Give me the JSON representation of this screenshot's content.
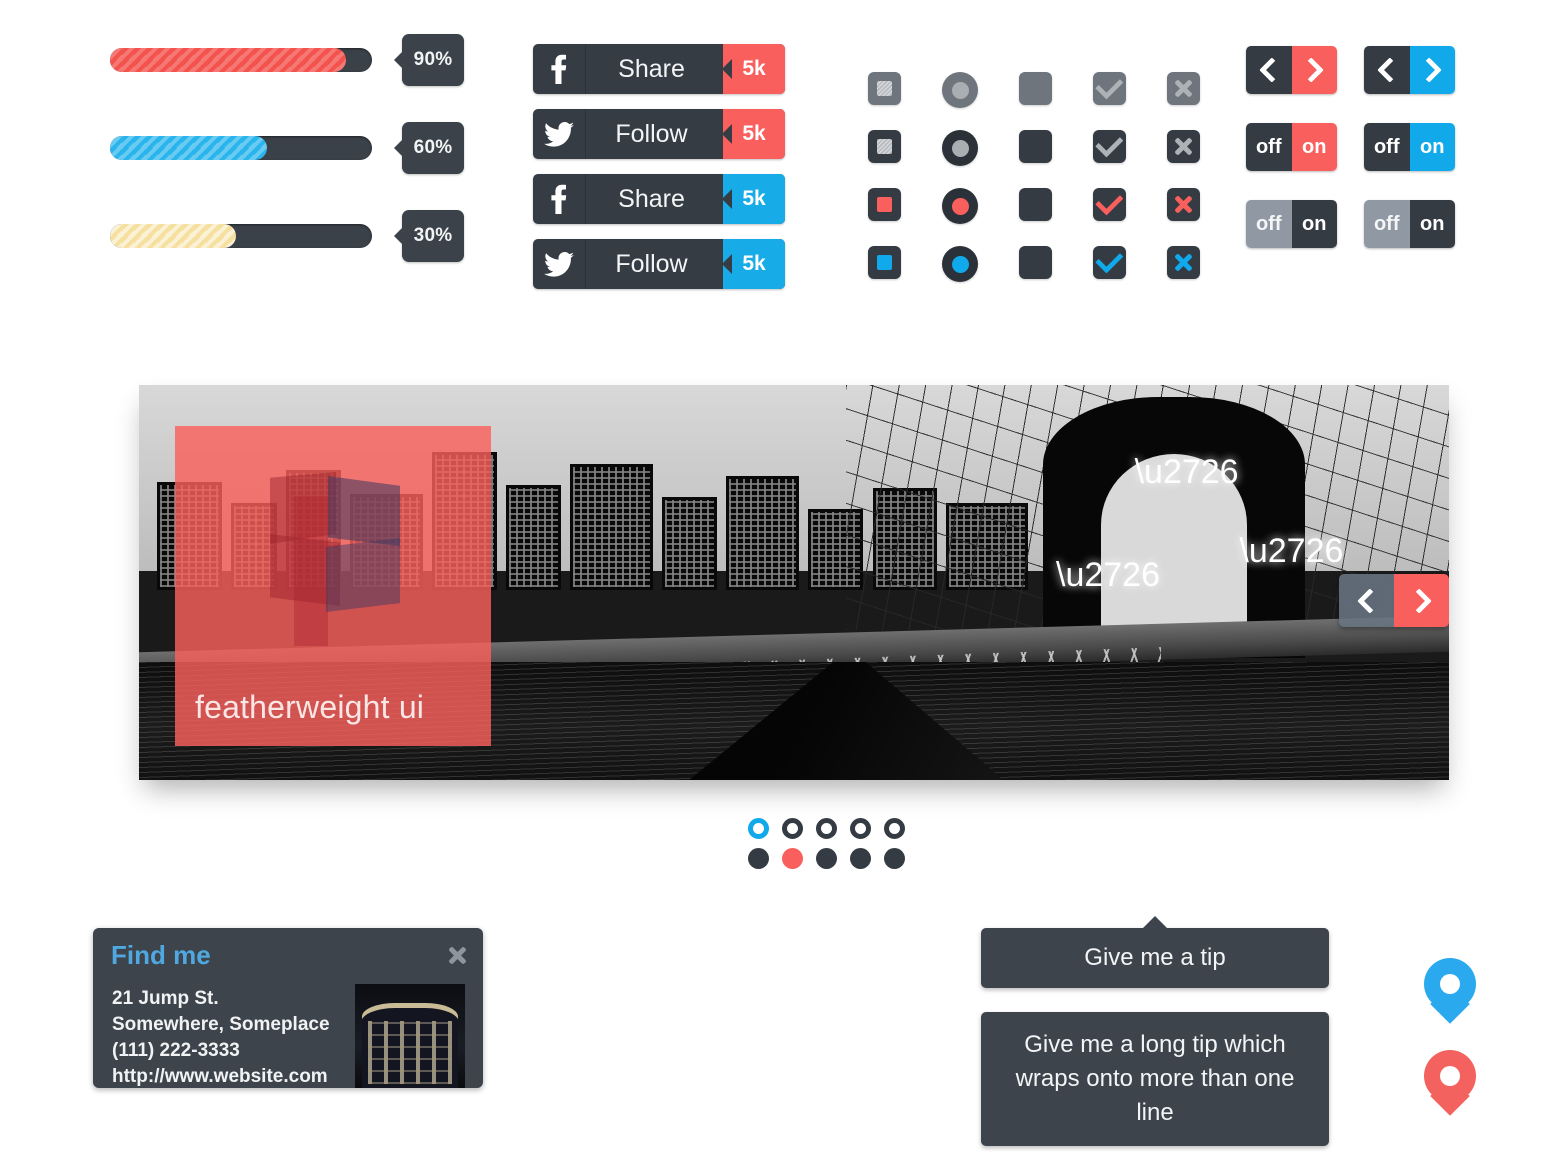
{
  "sliders": [
    {
      "value": "90%",
      "percent": 90,
      "color": "#f4524d",
      "name": "red"
    },
    {
      "value": "60%",
      "percent": 60,
      "color": "#2ab4ec",
      "name": "blue"
    },
    {
      "value": "30%",
      "percent": 30,
      "color": "#f6e0a0",
      "name": "yellow"
    }
  ],
  "social_buttons": [
    {
      "icon": "facebook-icon",
      "glyph": "f",
      "label": "Share",
      "count": "5k",
      "accent": "#f9605d"
    },
    {
      "icon": "twitter-icon",
      "glyph": "✉",
      "label": "Follow",
      "count": "5k",
      "accent": "#f9605d"
    },
    {
      "icon": "facebook-icon",
      "glyph": "f",
      "label": "Share",
      "count": "5k",
      "accent": "#17abe8"
    },
    {
      "icon": "twitter-icon",
      "glyph": "✉",
      "label": "Follow",
      "count": "5k",
      "accent": "#17abe8"
    }
  ],
  "control_grid": {
    "rows": [
      {
        "state": "disabled",
        "accent": "#b4b8bc"
      },
      {
        "state": "default",
        "accent": "#b4b8bc"
      },
      {
        "state": "red",
        "accent": "#f9605d"
      },
      {
        "state": "blue",
        "accent": "#10a9ec"
      }
    ],
    "columns": [
      "checkbox-filled",
      "radio",
      "checkbox-empty",
      "checkbox-tick",
      "checkbox-cross"
    ]
  },
  "arrow_buttons": [
    {
      "prev": "‹",
      "next": "›",
      "accent": "#f9605d"
    },
    {
      "prev": "‹",
      "next": "›",
      "accent": "#11a9ea"
    }
  ],
  "toggles": [
    {
      "off_label": "off",
      "on_label": "on",
      "active": "on",
      "accent": "#f9605d"
    },
    {
      "off_label": "off",
      "on_label": "on",
      "active": "on",
      "accent": "#11a9ea"
    },
    {
      "off_label": "off",
      "on_label": "on",
      "active": "off",
      "accent": "#8f98a3"
    },
    {
      "off_label": "off",
      "on_label": "on",
      "active": "off",
      "accent": "#8f98a3"
    }
  ],
  "slider_panel": {
    "overlay_title": "featherweight ui",
    "logo_name": "featherweight-logo",
    "image_description": "black and white night photo of the Brooklyn Bridge and Manhattan skyline",
    "prev_label": "‹",
    "next_label": "›"
  },
  "pagination": {
    "rings": [
      {
        "active": true
      },
      {
        "active": false
      },
      {
        "active": false
      },
      {
        "active": false
      },
      {
        "active": false
      }
    ],
    "dots": [
      {
        "active": false
      },
      {
        "active": true
      },
      {
        "active": false
      },
      {
        "active": false
      },
      {
        "active": false
      }
    ],
    "ring_active_color": "#11a9ea",
    "dot_active_color": "#f9605d"
  },
  "find_me_card": {
    "title": "Find me",
    "close_icon": "close-icon",
    "close_glyph": "✖",
    "lines": [
      "21 Jump St.",
      "Somewhere, Someplace",
      "(111) 222-3333",
      "http://www.website.com"
    ],
    "thumbnail_alt": "night building photo"
  },
  "tooltips": [
    {
      "text": "Give me a tip",
      "has_arrow": true
    },
    {
      "text": "Give me a long tip which wraps onto more than one line",
      "has_arrow": false
    }
  ],
  "map_pins": [
    {
      "color": "#2aa9ef",
      "name": "map-pin-blue"
    },
    {
      "color": "#f4625f",
      "name": "map-pin-red"
    }
  ]
}
